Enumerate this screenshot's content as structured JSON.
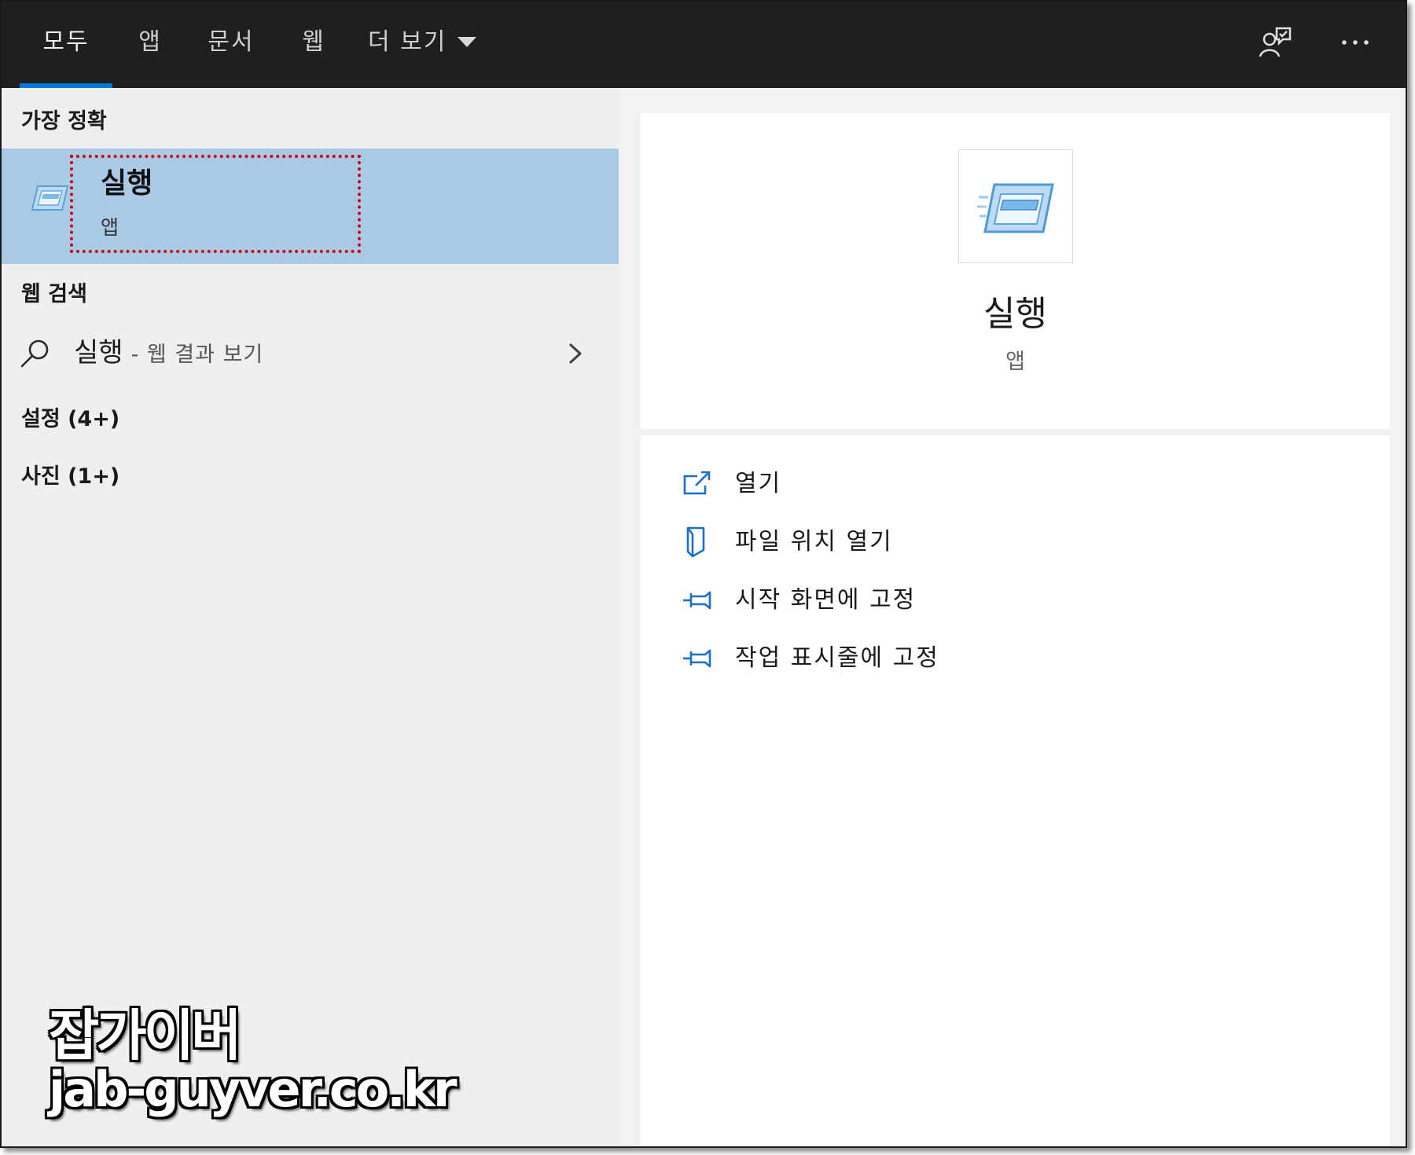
{
  "tabs": [
    {
      "label": "모두",
      "active": true
    },
    {
      "label": "앱"
    },
    {
      "label": "문서"
    },
    {
      "label": "웹"
    },
    {
      "label": "더 보기",
      "icon": "caret-down-icon"
    }
  ],
  "topbar": {
    "feedback_icon": "feedback-icon",
    "more_icon": "more-options-icon"
  },
  "left": {
    "best_match_heading": "가장 정확",
    "best_match": {
      "title": "실행",
      "subtitle": "앱",
      "icon": "run-app-icon",
      "highlighted": true
    },
    "web_heading": "웹 검색",
    "web_result": {
      "query": "실행",
      "suffix": "- 웹 결과 보기",
      "icon": "search-icon"
    },
    "settings": "설정 (4+)",
    "photos": "사진 (1+)"
  },
  "detail": {
    "title": "실행",
    "subtitle": "앱",
    "icon": "run-app-icon",
    "actions": [
      {
        "label": "열기",
        "icon": "open-icon"
      },
      {
        "label": "파일 위치 열기",
        "icon": "file-location-icon"
      },
      {
        "label": "시작 화면에 고정",
        "icon": "pin-icon"
      },
      {
        "label": "작업 표시줄에 고정",
        "icon": "pin-icon"
      }
    ]
  },
  "watermark": {
    "line1": "잡가이버",
    "line2": "jab-guyver.co.kr"
  },
  "colors": {
    "topbar_bg": "#1f1f1f",
    "accent": "#0078d7",
    "selected_bg": "#a9c9e5",
    "highlight_box": "#d0021b",
    "action_icon": "#1a6fc7"
  }
}
